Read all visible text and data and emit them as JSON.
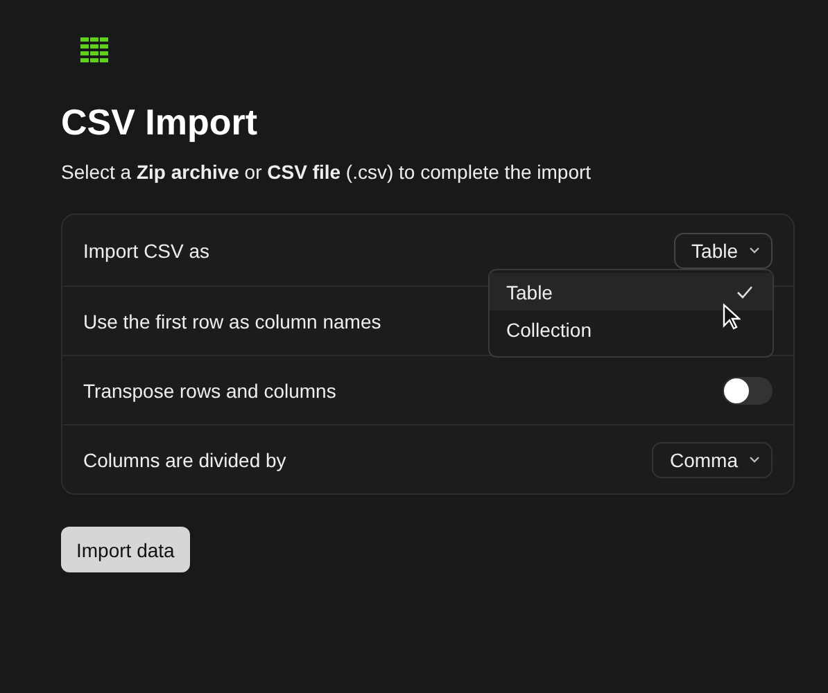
{
  "title": "CSV Import",
  "subtitle": "Select a **Zip archive** or **CSV file** (.csv) to complete the import",
  "settings": [
    {
      "label": "Import CSV as",
      "kind": "select",
      "value": "Table",
      "expanded": true
    },
    {
      "label": "Use the first row as column names",
      "kind": "hidden"
    },
    {
      "label": "Transpose rows and columns",
      "kind": "toggle",
      "on": false
    },
    {
      "label": "Columns are divided by",
      "kind": "select",
      "value": "Comma",
      "expanded": false
    }
  ],
  "dropdown": {
    "options": [
      {
        "label": "Table",
        "selected": true
      },
      {
        "label": "Collection",
        "selected": false
      }
    ]
  },
  "import_button": "Import data"
}
